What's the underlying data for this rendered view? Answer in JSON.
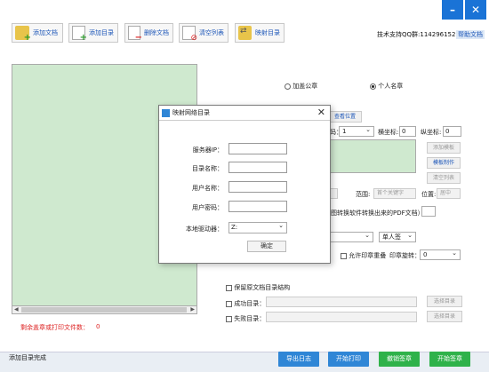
{
  "window": {
    "minimize_label": "–",
    "close_label": "✕"
  },
  "toolbar": {
    "items": [
      {
        "label": "添加文档",
        "icon": "folder-add-icon"
      },
      {
        "label": "添加目录",
        "icon": "document-add-icon"
      },
      {
        "label": "删除文档",
        "icon": "document-delete-icon"
      },
      {
        "label": "清空列表",
        "icon": "clear-list-icon"
      },
      {
        "label": "映射目录",
        "icon": "map-folder-icon"
      }
    ],
    "support": "技术支持QQ群:114296152",
    "help": "帮助文档"
  },
  "left": {
    "remaining_label": "剩余盖章或打印文件数：",
    "remaining_count": "0"
  },
  "options": {
    "radio_official": "加盖公章",
    "radio_personal": "个人名章",
    "preview_position": "查看位置",
    "page_label": "码：",
    "page_value": "1",
    "x_label": "横坐标:",
    "x_value": "0",
    "y_label": "纵坐标:",
    "y_value": "0",
    "btn_add_seal": "添加模板",
    "btn_make_template": "模板制作",
    "btn_clear_list": "清空列表",
    "range_label": "范围:",
    "range_placeholder": "首个关键字",
    "position_label": "位置:",
    "position_value": "居中",
    "note": "图转换软件转换出来的PDF文档）",
    "stamp_type": "单人签",
    "allow_overlap": "允许印章重叠",
    "rotate_label": "印章旋转：",
    "rotate_value": "0",
    "keep_structure": "保留原文档目录结构",
    "success_dir": "成功目录：",
    "fail_dir": "失败目录：",
    "choose_dir": "选择目录"
  },
  "status": {
    "text": "添加目录完成"
  },
  "bottom_buttons": [
    {
      "label": "导出日志",
      "color": "#2f86d6"
    },
    {
      "label": "开始打印",
      "color": "#2f86d6"
    },
    {
      "label": "撤销签章",
      "color": "#2fb24a"
    },
    {
      "label": "开始签章",
      "color": "#2fb24a"
    }
  ],
  "dialog": {
    "title": "映射网络目录",
    "server_ip": "服务器IP：",
    "dir_name": "目录名称：",
    "username": "用户名称：",
    "password": "用户密码：",
    "local_drive": "本地驱动器：",
    "drive_value": "Z:",
    "ok": "确定"
  }
}
